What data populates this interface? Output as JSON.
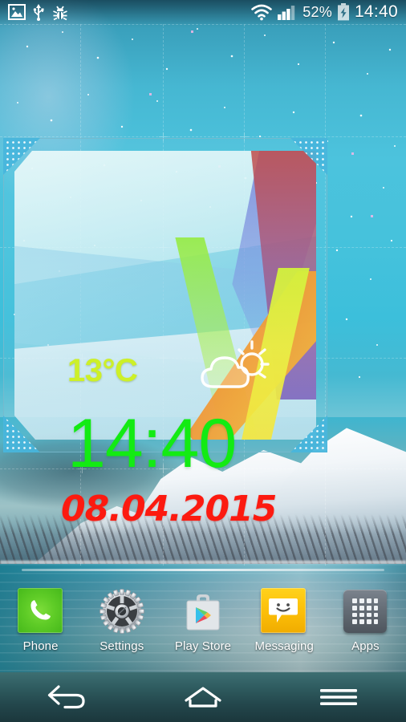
{
  "status_bar": {
    "left_icons": [
      {
        "name": "gallery-icon",
        "label": "Screenshot / image"
      },
      {
        "name": "usb-icon",
        "label": "USB connected"
      },
      {
        "name": "bug-icon",
        "label": "USB debugging"
      }
    ],
    "right_icons": [
      {
        "name": "wifi-icon",
        "label": "Wi-Fi"
      },
      {
        "name": "signal-icon",
        "label": "Mobile signal"
      },
      {
        "name": "battery-charging-icon",
        "label": "Battery charging"
      }
    ],
    "battery_percent": "52%",
    "clock": "14:40"
  },
  "widget": {
    "name": "Weather clock widget",
    "temperature": "13°C",
    "temperature_color": "#cdf028",
    "weather_icon": "partly-cloudy-icon",
    "time": "14:40",
    "time_color": "#13eb13",
    "date": "08.04.2015",
    "date_color": "#fc1a10"
  },
  "dock": {
    "items": [
      {
        "label": "Phone",
        "icon": "phone-icon",
        "color": "#5fcc27"
      },
      {
        "label": "Settings",
        "icon": "gear-icon",
        "color": "#b9bec4"
      },
      {
        "label": "Play Store",
        "icon": "play-store-icon",
        "color": "#d9dcdf"
      },
      {
        "label": "Messaging",
        "icon": "messaging-icon",
        "color": "#fcbe08"
      },
      {
        "label": "Apps",
        "icon": "apps-grid-icon",
        "color": "#636b74"
      }
    ]
  },
  "nav_bar": {
    "buttons": [
      {
        "name": "back-button",
        "icon": "back-arrow-icon"
      },
      {
        "name": "home-button",
        "icon": "home-icon"
      },
      {
        "name": "menu-button",
        "icon": "menu-lines-icon"
      }
    ]
  },
  "wallpaper": {
    "description": "Snow-capped mountains over a lake under a starry teal sky",
    "sky_color": "#45c2dc",
    "water_color": "#5e97a4"
  }
}
